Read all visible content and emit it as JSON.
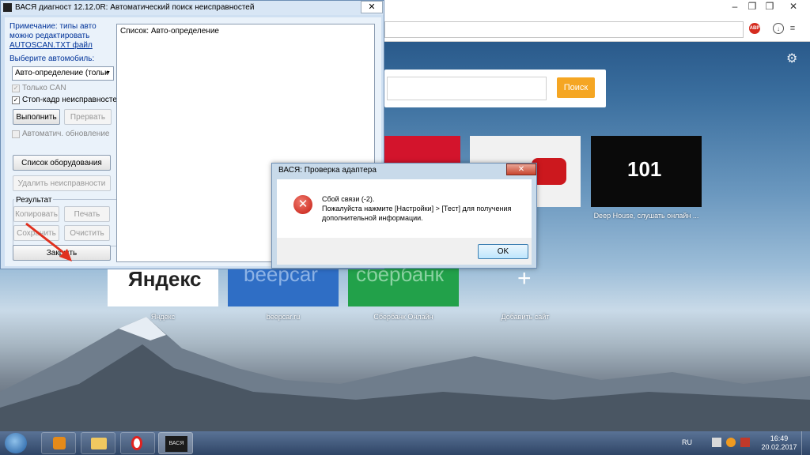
{
  "browser": {
    "search_button": "Поиск",
    "tiles": [
      {
        "label": "Deep House, слушать онлайн ..."
      },
      {
        "label": "Яндекс"
      },
      {
        "label": "beepcar.ru"
      },
      {
        "label": "Сбербанк Онлайн"
      },
      {
        "label": "Добавить сайт"
      }
    ],
    "tile_text_101": "101",
    "tile_text_yandex": "Яндекс",
    "tile_text_beep": "beepcar",
    "tile_text_sber": "сбербанк",
    "abp": "ABP"
  },
  "app": {
    "title": "ВАСЯ диагност 12.12.0R:  Автоматический поиск неисправностей",
    "note_line1": "Примечание: типы авто",
    "note_line2": "можно редактировать",
    "note_link": "AUTOSCAN.TXT файл",
    "choose_car": "Выберите автомобиль:",
    "car_select": "Авто-определение (тольк",
    "only_can": "Только CAN",
    "freeze_frame": "Стоп-кадр неисправностей",
    "run_button": "Выполнить",
    "abort_button": "Прервать",
    "auto_update": "Автоматич. обновление",
    "equipment_button": "Список оборудования",
    "delete_faults_button": "Удалить неисправности",
    "result_group": "Результат",
    "copy_button": "Копировать",
    "print_button": "Печать",
    "save_button": "Сохранить",
    "clear_button": "Очистить",
    "close_button": "Закрыть",
    "list_text": "Список: Авто-определение"
  },
  "dialog": {
    "title": "ВАСЯ: Проверка адаптера",
    "line1": "Сбой связи (-2).",
    "line2": "Пожалуйста нажмите [Настройки] > [Тест] для получения",
    "line3": "дополнительной информации.",
    "ok": "OK"
  },
  "taskbar": {
    "lang": "RU",
    "time": "16:49",
    "date": "20.02.2017",
    "vasya_label": "ВАСЯ"
  },
  "colors": {
    "search_button": "#f5a623",
    "error_icon": "#c41a10"
  }
}
